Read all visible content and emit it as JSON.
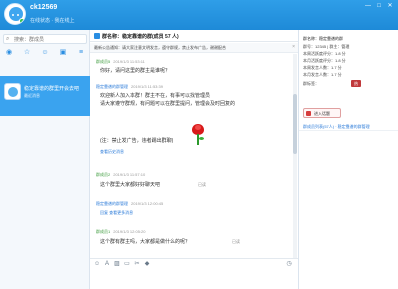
{
  "header": {
    "username": "ck12569",
    "status": "在线状态 · 我在线上",
    "window_controls": [
      "—",
      "□",
      "✕"
    ]
  },
  "left": {
    "search_placeholder": "搜索：群成员",
    "tabs": [
      "chat-bubble-icon",
      "star-icon",
      "contacts-icon",
      "group-icon",
      "more-icon"
    ],
    "conversation": {
      "name": "稳定靠谱的群里开会去吧",
      "sub": "最近消息"
    }
  },
  "chat": {
    "title": "群名称：稳定靠谱的群(成员 57 人)",
    "notice": "最新公告通知：请大家注意文明发言，遵守群规，禁止发布广告，谢谢配合",
    "messages": [
      {
        "name": "群成员5",
        "time": "2019/1/3 11:53:11",
        "lines": [
          "你好，请问这里的群主是谁呢？"
        ]
      },
      {
        "name": "稳定靠谱的群管理",
        "time": "2019/1/3 11:53:39",
        "lines": [
          "欢迎新人加入本群！群主不在，有事可以找管理员",
          "请大家遵守群规，有问题可以在群里提问，管理会及时回复的",
          "",
          "(注：禁止发广告，违者踢出群聊)"
        ],
        "link": "查看历史消息"
      },
      {
        "name": "群成员2",
        "time": "2019/1/3 11:57:10",
        "lines": [
          "这个群里大家都好好聊天吧"
        ],
        "extra": "已读"
      },
      {
        "name": "稳定靠谱的群管理",
        "time": "2019/1/3 12:00:45",
        "link_line": "回复 查看更多消息"
      },
      {
        "name": "群成员1",
        "time": "2019/1/3 12:05:20",
        "lines": [
          "这个群有群主吗，大家都是做什么的呢？"
        ],
        "extra": "已读"
      }
    ],
    "toolbar": [
      "emoji-icon",
      "font-icon",
      "image-icon",
      "folder-icon",
      "scissors-icon",
      "gift-icon",
      "history-icon"
    ]
  },
  "right": {
    "lines": [
      {
        "label": "群名称：稳定靠谱的群",
        "kind": "title"
      },
      {
        "label": "群号：12345 | 群主：管理"
      },
      {
        "label": "本周活跃度评分：1.8 分"
      },
      {
        "label": "本月活跃度评分：1.8 分"
      },
      {
        "label": "本周发言人数：1.7 分"
      },
      {
        "label": "本月发言人数：1.7 分"
      },
      {
        "label": "群标签："
      }
    ],
    "tag": "热",
    "button_label": "进入话题",
    "member_line": "群成员列表(57人) · 稳定靠谱的群管理"
  }
}
